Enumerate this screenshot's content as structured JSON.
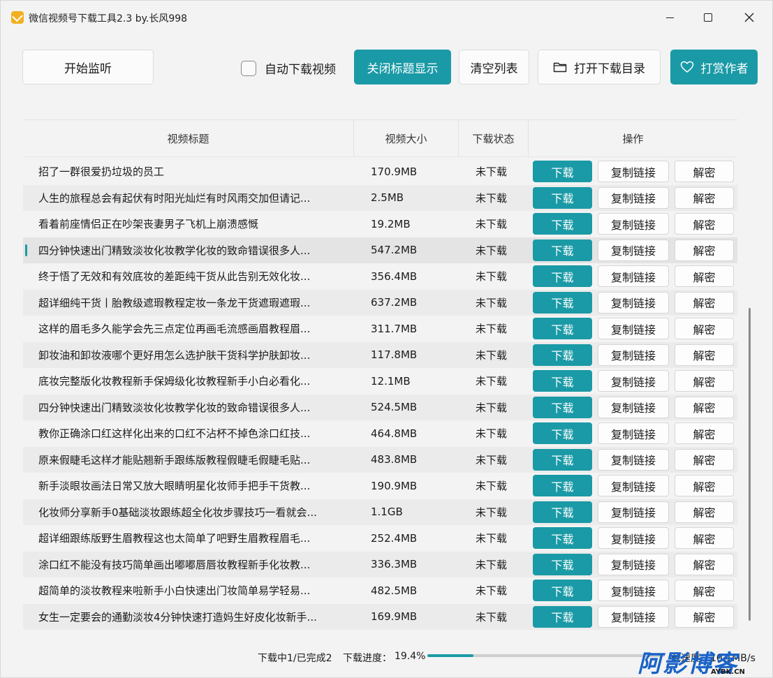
{
  "window": {
    "title": "微信视频号下载工具2.3 by.长风998"
  },
  "toolbar": {
    "start_listen": "开始监听",
    "auto_download": "自动下载视频",
    "close_title": "关闭标题显示",
    "clear_list": "清空列表",
    "open_dir": "打开下载目录",
    "reward": "打赏作者"
  },
  "table": {
    "headers": [
      "视频标题",
      "视频大小",
      "下载状态",
      "操作"
    ],
    "actions": {
      "download": "下载",
      "copy_link": "复制链接",
      "decrypt": "解密"
    },
    "rows": [
      {
        "title": "招了一群很爱扔垃圾的员工",
        "size": "170.9MB",
        "status": "未下载"
      },
      {
        "title": "人生的旅程总会有起伏有时阳光灿烂有时风雨交加但请记...",
        "size": "2.5MB",
        "status": "未下载"
      },
      {
        "title": "看着前座情侣正在吵架丧妻男子飞机上崩溃感慨",
        "size": "19.2MB",
        "status": "未下载"
      },
      {
        "title": "四分钟快速出门精致淡妆化妆教学化妆的致命错误很多人...",
        "size": "547.2MB",
        "status": "未下载"
      },
      {
        "title": "终于悟了无效和有效底妆的差距纯干货从此告别无效化妆...",
        "size": "356.4MB",
        "status": "未下载"
      },
      {
        "title": "超详细纯干货丨胎教级遮瑕教程定妆一条龙干货遮瑕遮瑕...",
        "size": "637.2MB",
        "status": "未下载"
      },
      {
        "title": "这样的眉毛多久能学会先三点定位再画毛流感画眉教程眉...",
        "size": "311.7MB",
        "status": "未下载"
      },
      {
        "title": "卸妆油和卸妆液哪个更好用怎么选护肤干货科学护肤卸妆...",
        "size": "117.8MB",
        "status": "未下载"
      },
      {
        "title": "底妆完整版化妆教程新手保姆级化妆教程新手小白必看化...",
        "size": "12.1MB",
        "status": "未下载"
      },
      {
        "title": "四分钟快速出门精致淡妆化妆教学化妆的致命错误很多人...",
        "size": "524.5MB",
        "status": "未下载"
      },
      {
        "title": "教你正确涂口红这样化出来的口红不沾杯不掉色涂口红技...",
        "size": "464.8MB",
        "status": "未下载"
      },
      {
        "title": "原来假睫毛这样才能贴翘新手跟练版教程假睫毛假睫毛贴...",
        "size": "483.8MB",
        "status": "未下载"
      },
      {
        "title": "新手淡眼妆画法日常又放大眼睛明星化妆师手把手干货教...",
        "size": "190.9MB",
        "status": "未下载"
      },
      {
        "title": "化妆师分享新手0基础淡妆跟练超全化妆步骤技巧一看就会...",
        "size": "1.1GB",
        "status": "未下载"
      },
      {
        "title": "超详细跟练版野生眉教程这也太简单了吧野生眉教程眉毛...",
        "size": "252.4MB",
        "status": "未下载"
      },
      {
        "title": "涂口红不能没有技巧简单画出嘟嘟唇唇妆教程新手化妆教...",
        "size": "336.3MB",
        "status": "未下载"
      },
      {
        "title": "超简单的淡妆教程来啦新手小白快速出门妆简单易学轻易...",
        "size": "482.5MB",
        "status": "未下载"
      },
      {
        "title": "女生一定要会的通勤淡妆4分钟快速打造妈生好皮化妆新手...",
        "size": "169.9MB",
        "status": "未下载"
      }
    ],
    "selected_index": 3
  },
  "status": {
    "progress_summary": "下载中1/已完成2",
    "progress_label": "下载进度：",
    "progress_percent": "19.4%",
    "progress_value": 0.194,
    "speed_partial": "载速度：10.1MB/s"
  },
  "watermark": {
    "logo": "阿影博客",
    "sub": "AYBK.CN"
  },
  "colors": {
    "accent": "#1a9aa6"
  }
}
